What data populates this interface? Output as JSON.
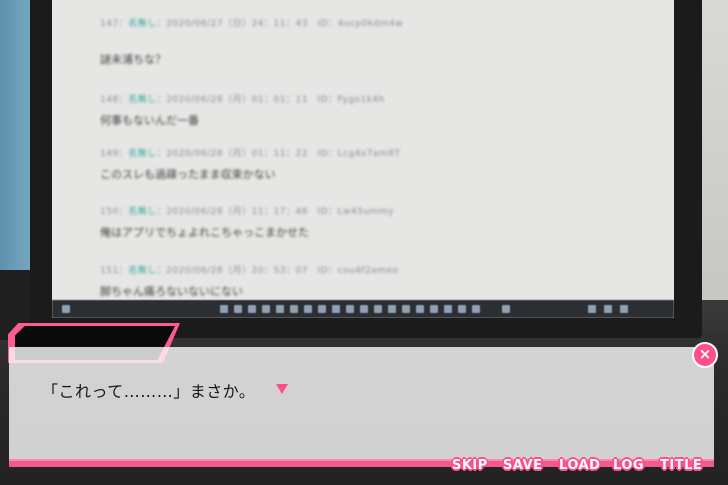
{
  "background": {
    "posts": [
      {
        "meta_prefix": "147：",
        "name": "名無し",
        "meta_suffix": "：2020/06/27（日）24：11：43　ID：4ucp0kdm4w",
        "body": "謎未浦ちな？"
      },
      {
        "meta_prefix": "148：",
        "name": "名無し",
        "meta_suffix": "：2020/06/28（月）01：01：11　ID：Fygo1k4h",
        "body": "何事もないんだ一番"
      },
      {
        "meta_prefix": "149：",
        "name": "名無し",
        "meta_suffix": "：2020/06/28（月）01：11：22　ID：Lcg4x7am8T",
        "body": "このスレも過疎ったまま収束かない"
      },
      {
        "meta_prefix": "150：",
        "name": "名無し",
        "meta_suffix": "：2020/06/28（月）11：17：48　ID：Lw45ummy",
        "body": "俺はアプリでちょよれこちゃっこまかせた"
      },
      {
        "meta_prefix": "151：",
        "name": "名無し",
        "meta_suffix": "：2020/06/28（月）20：53：07　ID：cou4f2ameo",
        "body": "脚ちゃん痛ろないないにない"
      }
    ]
  },
  "speaker": {
    "name": ""
  },
  "dialogue": {
    "text": "「これって………」まさか。"
  },
  "controls": {
    "close_label": "×",
    "skip_label": "SKIP",
    "save_label": "SAVE",
    "load_label": "LOAD",
    "log_label": "LOG",
    "title_label": "TITLE"
  },
  "colors": {
    "accent": "#ff4f86",
    "nameplate": "#0a0a0a",
    "textbox": "#f8f8f8"
  },
  "icons": {
    "next": "triangle-down-icon",
    "close": "close-icon"
  }
}
